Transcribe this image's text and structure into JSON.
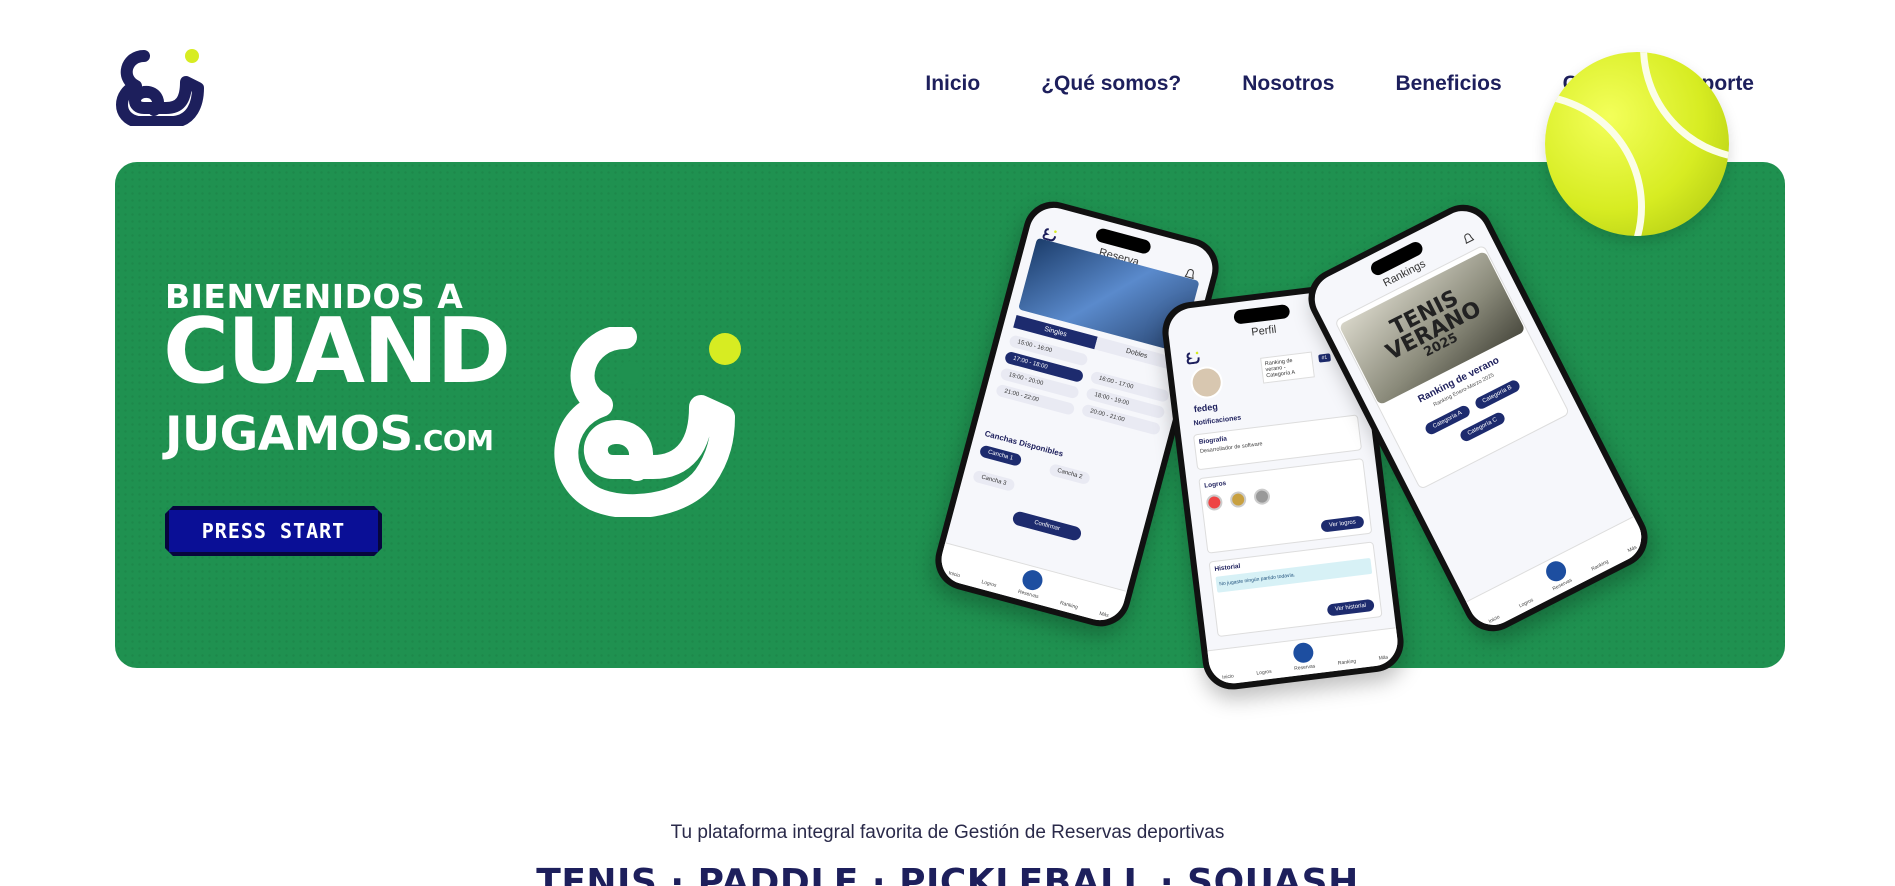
{
  "nav": {
    "items": [
      "Inicio",
      "¿Qué somos?",
      "Nosotros",
      "Beneficios",
      "Contacto y soporte"
    ]
  },
  "hero": {
    "welcome": "BIENVENIDOS A",
    "brand_line1": "CUAND",
    "brand_line2": "JUGAMOS",
    "brand_domain": ".COM",
    "cta_label": "PRESS START",
    "colors": {
      "background": "#1f9150",
      "accent": "#d7ec22",
      "navy": "#1d1f5c",
      "button": "#0a0f96"
    }
  },
  "phone_reserva": {
    "title": "Reserva",
    "tabs": [
      "Singles",
      "Dobles"
    ],
    "slots_left": [
      "15:00 - 16:00",
      "17:00 - 18:00",
      "19:00 - 20:00",
      "21:00 - 22:00"
    ],
    "slots_right": [
      "16:00 - 17:00",
      "18:00 - 19:00",
      "20:00 - 21:00"
    ],
    "courts_heading": "Canchas Disponibles",
    "courts": [
      "Cancha 1",
      "Cancha 2",
      "Cancha 3"
    ],
    "confirm": "Confirmar",
    "tabbar": [
      "Inicio",
      "Logros",
      "Reservas",
      "Ranking",
      "Más"
    ]
  },
  "phone_perfil": {
    "title": "Perfil",
    "username": "fedeg",
    "ranking_text": "Ranking de verano - Categoría A",
    "ranking_badge": "#1",
    "notifications": "Notificaciones",
    "bio_heading": "Biografía",
    "bio_text": "Desarrollador de software",
    "achievements_heading": "Logros",
    "achievements_btn": "Ver logros",
    "history_heading": "Historial",
    "history_empty": "No jugaste ningún partido todavía.",
    "history_btn": "Ver historial",
    "tabbar": [
      "Inicio",
      "Logros",
      "Reservas",
      "Ranking",
      "Más"
    ]
  },
  "phone_rankings": {
    "title": "Rankings",
    "poster_line1": "TENIS",
    "poster_line2": "VERANO",
    "poster_line3": "2025",
    "card_title": "Ranking de verano",
    "card_sub": "Ranking Enero-Marzo 2025",
    "categories": [
      "Categoría A",
      "Categoría B",
      "Categoría C"
    ],
    "tabbar": [
      "Inicio",
      "Logros",
      "Reservas",
      "Ranking",
      "Más"
    ]
  },
  "tagline": "Tu plataforma integral favorita de Gestión de Reservas deportivas",
  "sports": "TENIS · PADDLE · PICKLEBALL · SQUASH"
}
